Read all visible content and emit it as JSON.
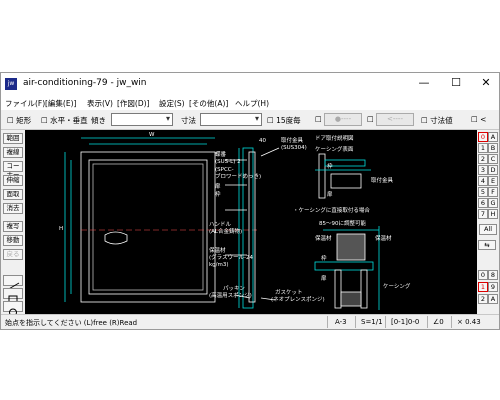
{
  "window": {
    "title": "air-conditioning-79 - jw_win",
    "app_icon_label": "jw",
    "controls": {
      "minimize": "—",
      "maximize": "☐",
      "close": "✕"
    }
  },
  "menubar": {
    "items": [
      "ファイル(F)",
      "[編集(E)]",
      "表示(V)",
      "[作図(D)]",
      "設定(S)",
      "[その他(A)]",
      "ヘルプ(H)"
    ]
  },
  "toolbar": {
    "rect_label": "矩形",
    "hv_label": "水平・垂直",
    "tilt_label": "傾き",
    "dim_label": "寸法",
    "deg15_label": "15度毎",
    "btn1_label": "●----",
    "btn2_label": "<----",
    "dimval_label": "寸法値",
    "lt_label": "<"
  },
  "leftbar": {
    "items": [
      "範囲",
      "複線",
      "コーナー",
      "伸縮",
      "面取",
      "消去",
      "複写",
      "移動",
      "戻る"
    ]
  },
  "rightbar": {
    "grid": [
      "0",
      "A",
      "1",
      "B",
      "2",
      "C",
      "3",
      "D",
      "4",
      "E",
      "5",
      "F",
      "6",
      "G",
      "7",
      "H"
    ],
    "all_label": "All",
    "bottom": [
      "0",
      "8",
      "1",
      "9",
      "2",
      "A"
    ]
  },
  "statusbar": {
    "message": "始点を指示してください (L)free (R)Read",
    "paper": "A-3",
    "scale": "S=1/1",
    "layer": "[0-1]0-0",
    "angle": "∠0",
    "zoom": "× 0.43"
  },
  "drawing": {
    "title_door": "ドア取付説明図",
    "label_upper_frame": "取付金具",
    "label_sus": "(SUS304)",
    "label_casing": "ケーシング表面",
    "label_frame": "枠",
    "label_door": "扉",
    "label_fit": "取付金具",
    "note_direct": "・ケーシングに直接取付る場合",
    "note_adjust": "85～90に調整可能",
    "label_insul1": "保温材",
    "label_insul2": "保温材",
    "label_frame2": "枠",
    "label_door2": "扉",
    "label_casing2": "ケーシング",
    "label_hinge": "蝶番",
    "label_hinge_spec": "(SUS-L) 2",
    "label_knob": "ハンドル",
    "label_knob_spec": "(AL合金鋳物)",
    "label_glass": "保温材",
    "label_glass_spec": "(グラスウール-24",
    "label_glass_spec2": "kg/m3)",
    "label_packing": "パッキン",
    "label_packing_spec": "(高温用スポンジ)",
    "label_gasket": "ガスケット",
    "label_gasket_spec": "(ネオプレンスポンジ)",
    "label_w": "W",
    "label_h": "H",
    "label_40": "40",
    "label_spcc": "(SPCC-",
    "label_spcc2": "ブロワードめっき)",
    "label_hinge_top": "蝶番",
    "label_door_top": "扉",
    "label_frame_top": "枠"
  }
}
